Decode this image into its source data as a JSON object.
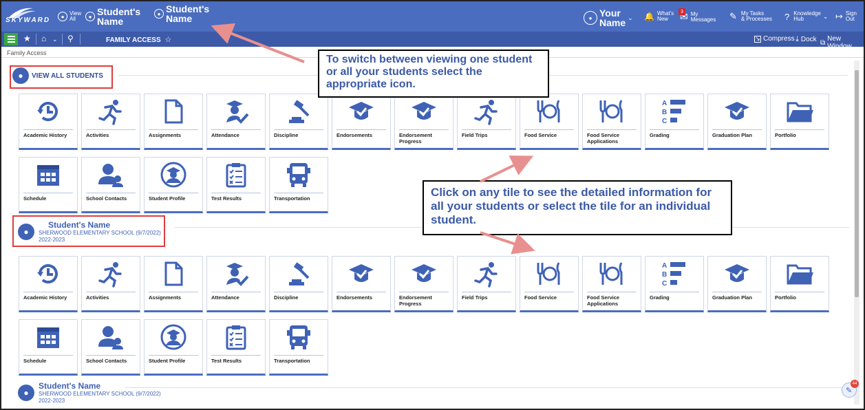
{
  "header": {
    "logo": "SKYWARD",
    "view_all_small": "View",
    "view_all_small2": "All",
    "student1_line1": "Student's",
    "student1_line2": "Name",
    "student2_line1": "Student's",
    "student2_line2": "Name",
    "your_name_line1": "Your",
    "your_name_line2": "Name",
    "whats_new_1": "What's",
    "whats_new_2": "New",
    "messages_badge": "3",
    "messages_1": "My",
    "messages_2": "Messages",
    "tasks_1": "My Tasks",
    "tasks_2": "& Processes",
    "knowledge_1": "Knowledge",
    "knowledge_2": "Hub",
    "signout_1": "Sign",
    "signout_2": "Out"
  },
  "navbar": {
    "family_access": "FAMILY ACCESS",
    "compress": "Compress",
    "dock": "Dock",
    "new_window": "New Window"
  },
  "breadcrumb": "Family Access",
  "sections": {
    "all": {
      "title": "VIEW ALL STUDENTS"
    },
    "student_a": {
      "name": "Student's  Name",
      "school": "SHERWOOD ELEMENTARY SCHOOL (9/7/2022)",
      "year": "2022-2023"
    },
    "student_b": {
      "name": "Student's  Name",
      "school": "SHERWOOD ELEMENTARY SCHOOL (9/7/2022)",
      "year": "2022-2023"
    }
  },
  "tiles": [
    "Academic History",
    "Activities",
    "Assignments",
    "Attendance",
    "Discipline",
    "Endorsements",
    "Endorsement Progress",
    "Field Trips",
    "Food Service",
    "Food Service Applications",
    "Grading",
    "Graduation Plan",
    "Portfolio",
    "Schedule",
    "School Contacts",
    "Student Profile",
    "Test Results",
    "Transportation"
  ],
  "callouts": {
    "top": "To switch between viewing one student or all your students select the appropriate icon.",
    "middle": "Click on any tile to see the detailed information for all your students or select the tile for an individual student."
  },
  "chat_badge": "44",
  "colors": {
    "header": "#4a6dc0",
    "nav": "#3c5aa8",
    "accent": "#3f62b5",
    "annotation": "#e03c3c"
  }
}
